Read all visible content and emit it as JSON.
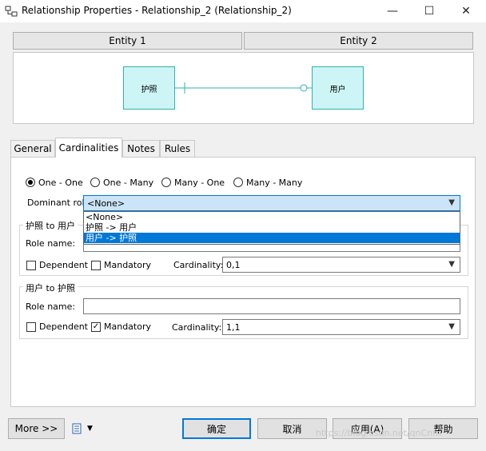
{
  "window": {
    "title": "Relationship Properties - Relationship_2 (Relationship_2)",
    "minimize_glyph": "—",
    "maximize_glyph": "☐",
    "close_glyph": "✕"
  },
  "entities": {
    "entity1_header": "Entity 1",
    "entity2_header": "Entity 2"
  },
  "diagram": {
    "left_entity": "护照",
    "right_entity": "用户"
  },
  "tabs": [
    {
      "label": "General",
      "active": false
    },
    {
      "label": "Cardinalities",
      "active": true
    },
    {
      "label": "Notes",
      "active": false
    },
    {
      "label": "Rules",
      "active": false
    }
  ],
  "cardinality_options": [
    {
      "label": "One - One",
      "selected": true
    },
    {
      "label": "One - Many",
      "selected": false
    },
    {
      "label": "Many - One",
      "selected": false
    },
    {
      "label": "Many - Many",
      "selected": false
    }
  ],
  "dominant_role": {
    "label": "Dominant role:",
    "value": "<None>",
    "options": [
      "<None>",
      "护照 -> 用户",
      "用户 -> 护照"
    ],
    "highlighted_index": 2
  },
  "group1": {
    "title": "护照 to 用户",
    "role_name_label": "Role name:",
    "role_name_value": "",
    "dependent_label": "Dependent",
    "dependent_checked": false,
    "mandatory_label": "Mandatory",
    "mandatory_checked": false,
    "cardinality_label": "Cardinality:",
    "cardinality_value": "0,1"
  },
  "group2": {
    "title": "用户 to 护照",
    "role_name_label": "Role name:",
    "role_name_value": "",
    "dependent_label": "Dependent",
    "dependent_checked": false,
    "mandatory_label": "Mandatory",
    "mandatory_checked": true,
    "cardinality_label": "Cardinality:",
    "cardinality_value": "1,1"
  },
  "footer": {
    "more_label": "More >>",
    "ok_label": "确定",
    "cancel_label": "取消",
    "apply_label": "应用(A)",
    "help_label": "帮助"
  },
  "watermark": "https://blog.csdn.net/qnCnfn",
  "colors": {
    "entity_fill": "#cdf5f5",
    "entity_border": "#2fb2b2",
    "selection": "#0078d7"
  }
}
